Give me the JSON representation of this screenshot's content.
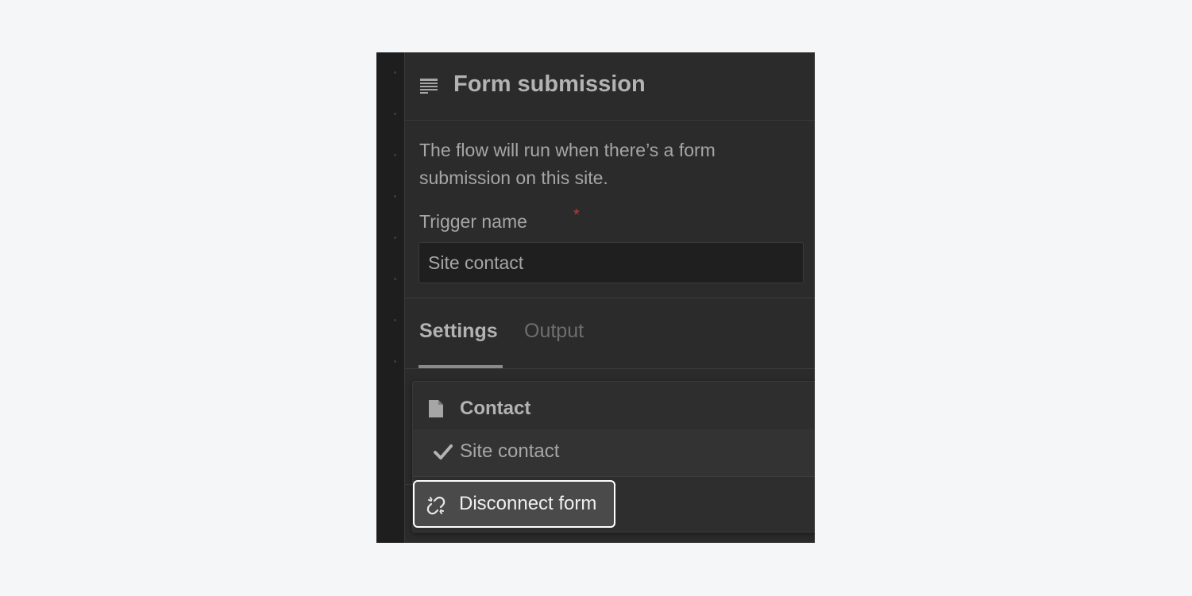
{
  "panel": {
    "title": "Form submission",
    "title_icon": "form-lines-icon",
    "description": "The flow will run when there’s a form submission on this site.",
    "trigger_field": {
      "label": "Trigger name",
      "required_mark": "*",
      "value": "Site contact"
    },
    "tabs": [
      {
        "label": "Settings",
        "active": true
      },
      {
        "label": "Output",
        "active": false
      }
    ]
  },
  "dropdown": {
    "group": {
      "label": "Contact",
      "icon": "document-icon"
    },
    "options": [
      {
        "label": "Site contact",
        "selected": true,
        "icon": "check-icon"
      }
    ],
    "action": {
      "label": "Disconnect form",
      "icon": "unlink-icon"
    }
  },
  "colors": {
    "panel_bg": "#2b2b2b",
    "page_bg": "#f5f6f8",
    "required": "#c0392b",
    "focus_outline": "#ffffff"
  }
}
